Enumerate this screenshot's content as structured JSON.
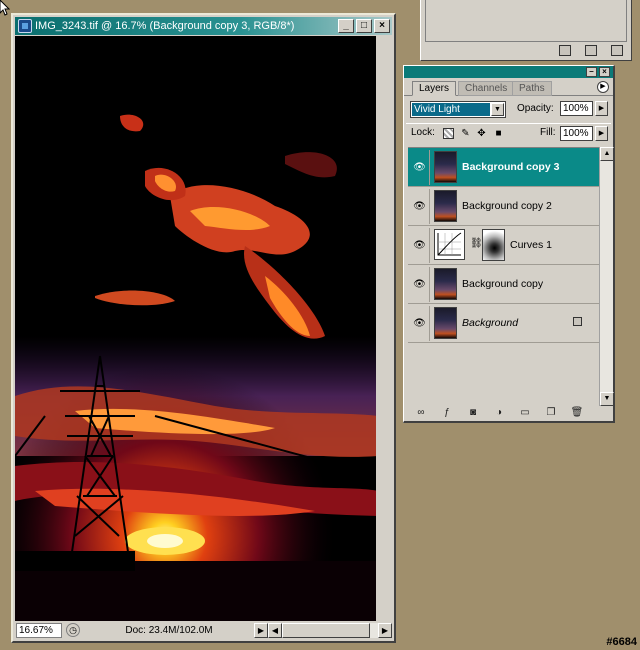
{
  "document": {
    "title": "IMG_3243.tif @ 16.7% (Background copy 3, RGB/8*)",
    "zoom": "16.67%",
    "doc_info": "Doc: 23.4M/102.0M"
  },
  "layers_panel": {
    "tabs": [
      "Layers",
      "Channels",
      "Paths"
    ],
    "blend_mode": "Vivid Light",
    "opacity_label": "Opacity:",
    "opacity": "100%",
    "lock_label": "Lock:",
    "fill_label": "Fill:",
    "fill": "100%",
    "layers": [
      {
        "name": "Background copy 3",
        "selected": true
      },
      {
        "name": "Background copy 2",
        "selected": false
      },
      {
        "name": "Curves 1",
        "selected": false
      },
      {
        "name": "Background copy",
        "selected": false
      },
      {
        "name": "Background",
        "selected": false
      }
    ]
  },
  "watermark": "#6684",
  "colors": {
    "desktop": "#a08f6c",
    "selected_layer": "#0a8a88",
    "titlebar": "#0a6e6e"
  }
}
